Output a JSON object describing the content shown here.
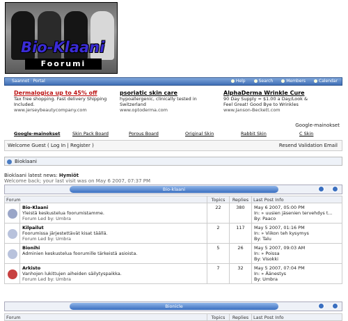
{
  "logo": {
    "title": "Bio-Klaani",
    "subtitle": "Foorumi"
  },
  "navbar": {
    "left": [
      "Saannot",
      "Portal"
    ],
    "right": [
      "Help",
      "Search",
      "Members",
      "Calendar"
    ]
  },
  "ads": [
    {
      "head": "Dermalogica up to 45% off",
      "line1": "Tax free shopping. Fast delivery Shipping",
      "line2": "Included.",
      "url": "www.jerseybeautycompany.com"
    },
    {
      "head": "psoriatic skin care",
      "line1": "hypoallergenic, clinically tested in",
      "line2": "Switzerland",
      "url": "www.optoderma.com"
    },
    {
      "head": "AlphaDerma Wrinkle Cure",
      "line1": "90 Day Supply = $1.00 a Day/Look &",
      "line2": "Feel Great! Good Bye to Wrinkles",
      "url": "www.Janson-Beckett.com"
    }
  ],
  "google_label": "Google-mainokset",
  "links": [
    "Google-mainokset",
    "Skin Pack Board",
    "Porous Board",
    "Original Skin",
    "Rabbit Skin",
    "C Skin"
  ],
  "welcome": {
    "text": "Welcome Guest ( Log In | Register )",
    "resend": "Resend Validation Email"
  },
  "category_bar": "Bioklaani",
  "news": {
    "label": "Bioklaani latest news:",
    "item": "Hymiöt",
    "last_visit": "Welcome back; your last visit was on May 6 2007, 07:37 PM"
  },
  "sections": [
    {
      "title": "Bio-klaani",
      "headers": [
        "Forum",
        "Topics",
        "Replies",
        "Last Post Info"
      ],
      "rows": [
        {
          "name": "Bio-Klaani",
          "desc": "Yleistä keskustelua foorumistamme.",
          "led": "Forum Led by: Umbra",
          "topics": "22",
          "replies": "380",
          "date": "May 6 2007, 05:00 PM",
          "in": "In: » uusien jäsenien tervehdys t...",
          "by": "By: Paaco",
          "icon": "#9aa6c8"
        },
        {
          "name": "Kilpailut",
          "desc": "Foorumissa järjestettävät kisat täällä.",
          "led": "Forum Led by: Umbra",
          "topics": "2",
          "replies": "117",
          "date": "May 5 2007, 01:16 PM",
          "in": "In: » Viikon teh kysymys",
          "by": "By: Talu",
          "icon": "#b8c2dc"
        },
        {
          "name": "Bionihi",
          "desc": "Adminien keskustelua foorumille tärkeistä asioista.",
          "led": "",
          "topics": "5",
          "replies": "26",
          "date": "May 5 2007, 09:03 AM",
          "in": "In: » Poissa",
          "by": "By: Visokki",
          "icon": "#b8c2dc"
        },
        {
          "name": "Arkisto",
          "desc": "Vanhojen lukittujen aiheiden säilytyspaikka.",
          "led": "Forum Led by: Umbra",
          "topics": "7",
          "replies": "32",
          "date": "May 5 2007, 07:04 PM",
          "in": "In: » Äänestys",
          "by": "By: Umbra",
          "icon": "#c84040"
        }
      ]
    },
    {
      "title": "Bionicle",
      "headers": [
        "Forum",
        "Topics",
        "Replies",
        "Last Post Info"
      ]
    }
  ]
}
